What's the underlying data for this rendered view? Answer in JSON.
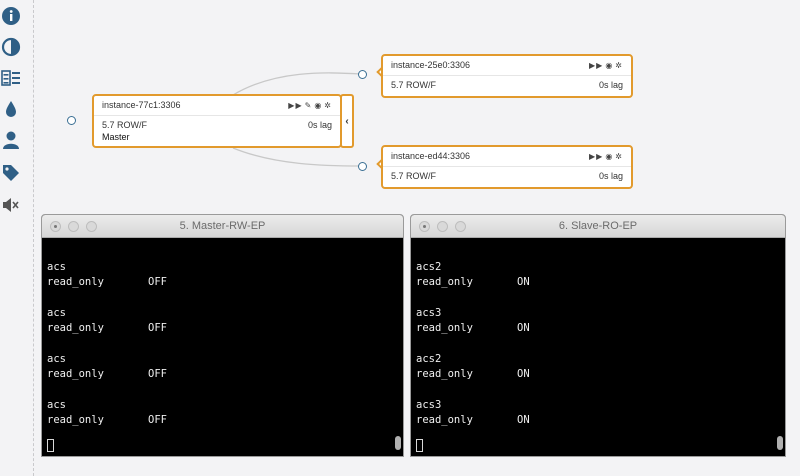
{
  "sidebar": {
    "icons": [
      "info-icon",
      "contrast-icon",
      "list-icon",
      "drop-icon",
      "user-icon",
      "tag-icon",
      "mute-icon"
    ]
  },
  "topology": {
    "master": {
      "name": "instance-77c1:3306",
      "version": "5.7 ROW/F",
      "lag": "0s lag",
      "role": "Master"
    },
    "replicas": [
      {
        "name": "instance-25e0:3306",
        "version": "5.7 ROW/F",
        "lag": "0s lag"
      },
      {
        "name": "instance-ed44:3306",
        "version": "5.7 ROW/F",
        "lag": "0s lag"
      }
    ],
    "collapse_glyph": "‹",
    "colors": {
      "accent": "#e29a2d",
      "link": "#3a6f94"
    }
  },
  "terminals": [
    {
      "title": "5. Master-RW-EP",
      "blocks": [
        {
          "host": "acs",
          "key": "read_only",
          "value": "OFF"
        },
        {
          "host": "acs",
          "key": "read_only",
          "value": "OFF"
        },
        {
          "host": "acs",
          "key": "read_only",
          "value": "OFF"
        },
        {
          "host": "acs",
          "key": "read_only",
          "value": "OFF"
        }
      ]
    },
    {
      "title": "6. Slave-RO-EP",
      "blocks": [
        {
          "host": "acs2",
          "key": "read_only",
          "value": "ON"
        },
        {
          "host": "acs3",
          "key": "read_only",
          "value": "ON"
        },
        {
          "host": "acs2",
          "key": "read_only",
          "value": "ON"
        },
        {
          "host": "acs3",
          "key": "read_only",
          "value": "ON"
        }
      ]
    }
  ]
}
